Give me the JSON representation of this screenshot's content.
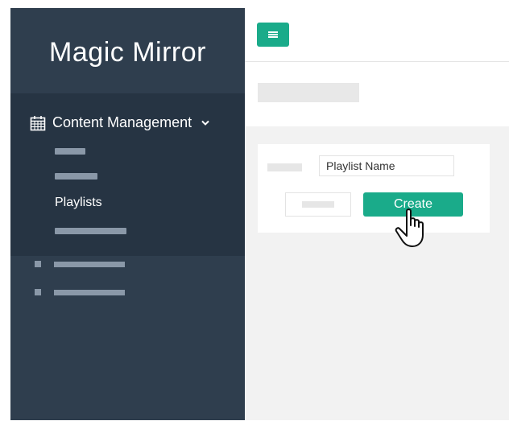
{
  "app": {
    "logo_text": "Magic Mirror"
  },
  "sidebar": {
    "group": {
      "icon": "calendar-icon",
      "label": "Content Management",
      "chevron": "chevron-down-icon",
      "active_item_label": "Playlists"
    }
  },
  "toolbar": {
    "menu_icon": "hamburger-menu-icon"
  },
  "form": {
    "name_input_value": "Playlist Name",
    "create_label": "Create"
  },
  "colors": {
    "sidebar": "#2f3e4e",
    "sidebar_group": "#263443",
    "accent": "#1aab8a",
    "content_bg": "#f2f2f2"
  },
  "pointer": "hand-pointer-icon"
}
